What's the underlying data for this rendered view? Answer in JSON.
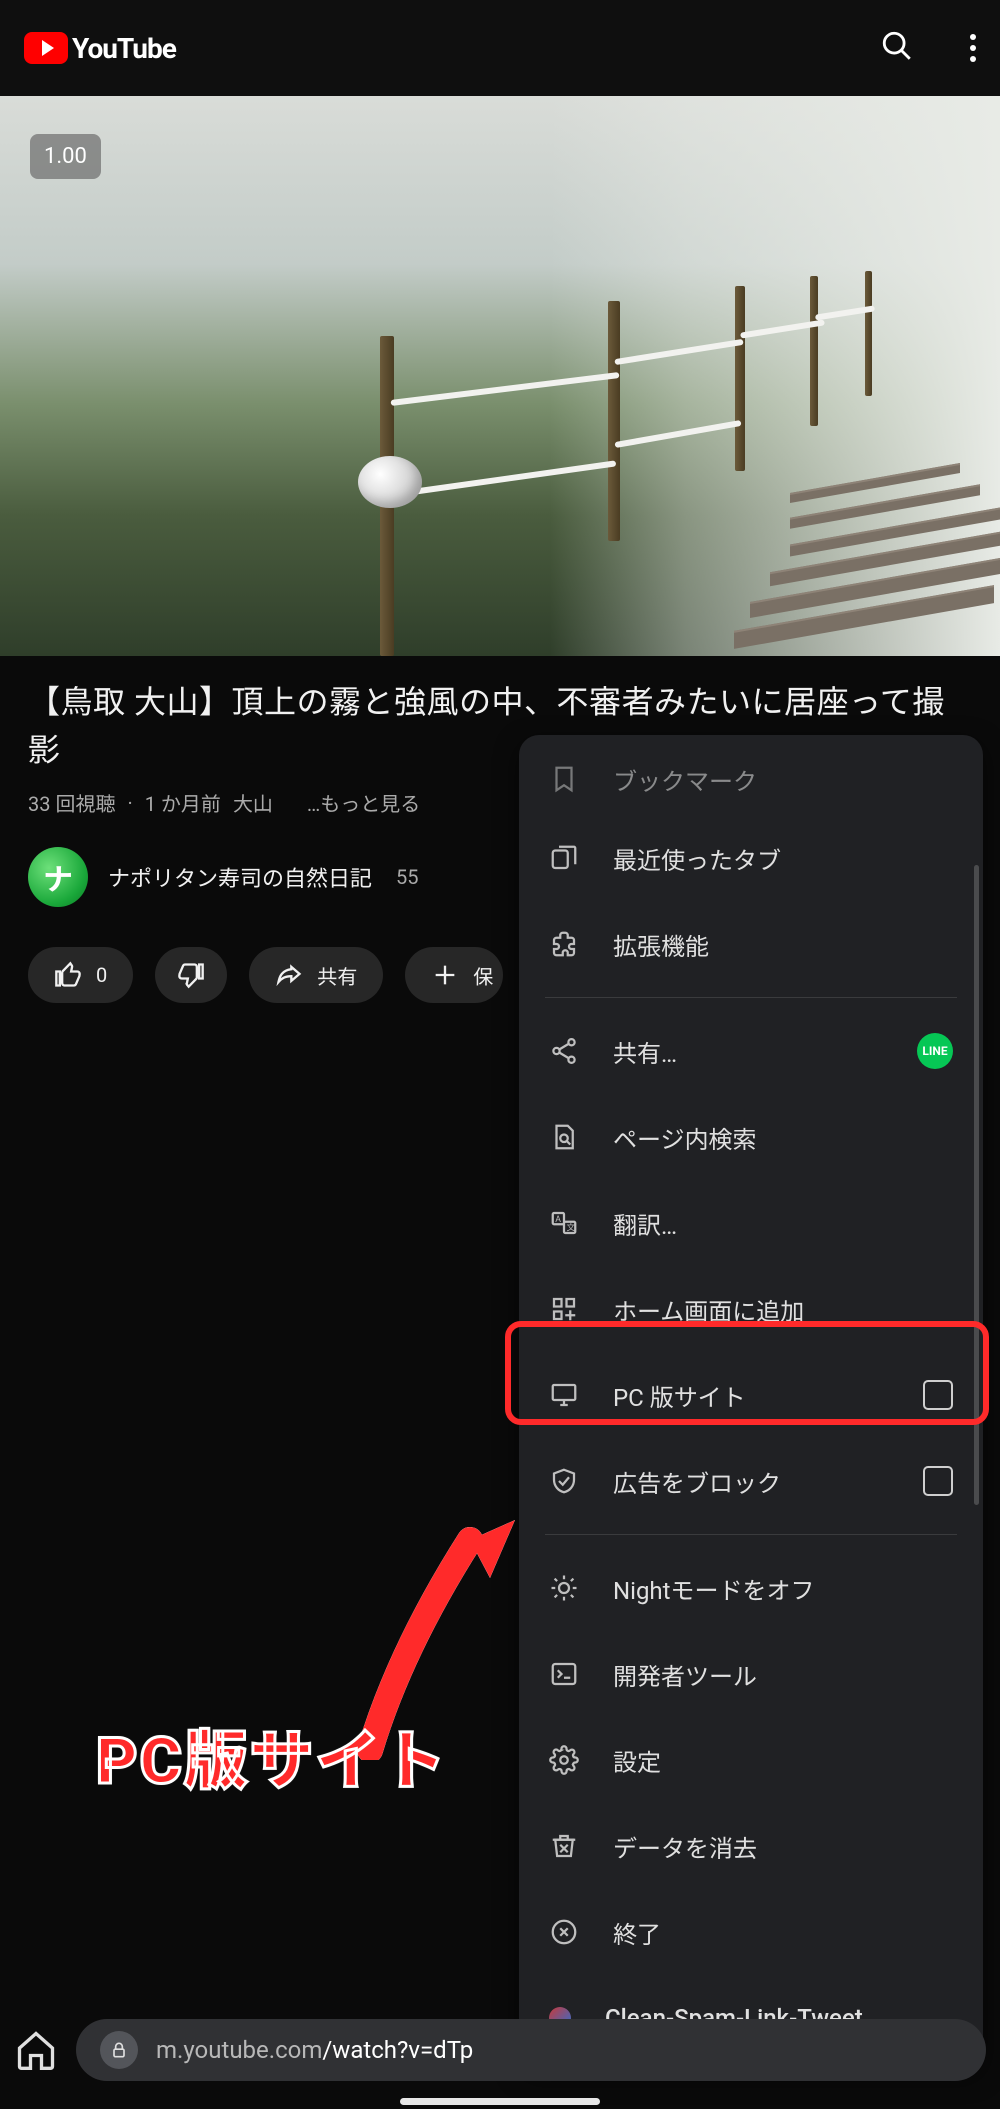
{
  "header": {
    "logo_text": "YouTube"
  },
  "video": {
    "speed_badge": "1.00",
    "title": "【鳥取 大山】頂上の霧と強風の中、不審者みたいに居座って撮影",
    "views": "33 回視聴",
    "age": "1 か月前",
    "tag": "大山",
    "more": "…もっと見る"
  },
  "channel": {
    "avatar_initial": "ナ",
    "name": "ナポリタン寿司の自然日記",
    "subs": "55"
  },
  "actions": {
    "like_count": "0",
    "share": "共有",
    "save": "保"
  },
  "menu": {
    "items": [
      {
        "key": "bookmark",
        "label": "ブックマーク",
        "icon": "bookmark"
      },
      {
        "key": "recent-tabs",
        "label": "最近使ったタブ",
        "icon": "tabs"
      },
      {
        "key": "extensions",
        "label": "拡張機能",
        "icon": "puzzle"
      },
      {
        "key": "share",
        "label": "共有…",
        "icon": "share",
        "trailing": "line"
      },
      {
        "key": "find-in-page",
        "label": "ページ内検索",
        "icon": "search-doc"
      },
      {
        "key": "translate",
        "label": "翻訳…",
        "icon": "translate"
      },
      {
        "key": "add-to-home",
        "label": "ホーム画面に追加",
        "icon": "grid-plus"
      },
      {
        "key": "desktop-site",
        "label": "PC 版サイト",
        "icon": "monitor",
        "trailing": "checkbox",
        "highlight": true
      },
      {
        "key": "block-ads",
        "label": "広告をブロック",
        "icon": "shield",
        "trailing": "checkbox"
      },
      {
        "key": "night-mode-off",
        "label": "Nightモードをオフ",
        "icon": "sun"
      },
      {
        "key": "devtools",
        "label": "開発者ツール",
        "icon": "terminal"
      },
      {
        "key": "settings",
        "label": "設定",
        "icon": "gear"
      },
      {
        "key": "clear-data",
        "label": "データを消去",
        "icon": "trash"
      },
      {
        "key": "quit",
        "label": "終了",
        "icon": "close"
      },
      {
        "key": "clean-spam",
        "label": "Clean-Spam-Link-Tweet",
        "icon": "ext-badge"
      }
    ],
    "line_badge_text": "LINE"
  },
  "annotation": {
    "label": "PC版サイト"
  },
  "urlbar": {
    "host": "m.youtube.com",
    "path": "/watch?v=dTp"
  }
}
